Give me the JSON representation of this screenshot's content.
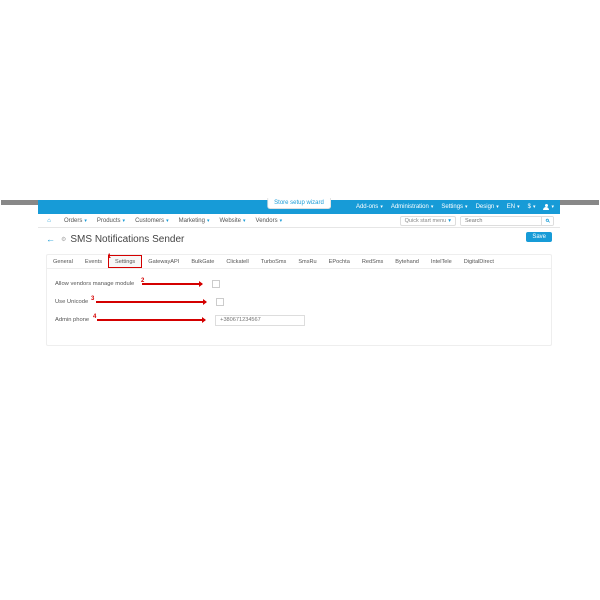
{
  "wizard_label": "Store setup wizard",
  "topbar": {
    "items": [
      {
        "label": "Add-ons"
      },
      {
        "label": "Administration"
      },
      {
        "label": "Settings"
      },
      {
        "label": "Design"
      },
      {
        "label": "EN"
      },
      {
        "label": "$"
      }
    ]
  },
  "menubar": {
    "items": [
      {
        "label": "Orders"
      },
      {
        "label": "Products"
      },
      {
        "label": "Customers"
      },
      {
        "label": "Marketing"
      },
      {
        "label": "Website"
      },
      {
        "label": "Vendors"
      }
    ],
    "quick_label": "Quick start menu",
    "search_placeholder": "Search"
  },
  "page_title": "SMS Notifications Sender",
  "save_label": "Save",
  "tabs": [
    "General",
    "Events",
    "Settings",
    "GatewayAPI",
    "BulkGate",
    "Clickatell",
    "TurboSms",
    "SmsRu",
    "EPochta",
    "RedSms",
    "Bytehand",
    "IntelTele",
    "DigitalDirect"
  ],
  "active_tab_index": 2,
  "form": {
    "rows": [
      {
        "label": "Allow vendors manage module",
        "type": "checkbox"
      },
      {
        "label": "Use Unicode",
        "type": "checkbox"
      },
      {
        "label": "Admin phone",
        "type": "text"
      }
    ],
    "phone_placeholder": "+380671234567"
  },
  "annotations": {
    "n1": "1",
    "n2": "2",
    "n3": "3",
    "n4": "4"
  }
}
